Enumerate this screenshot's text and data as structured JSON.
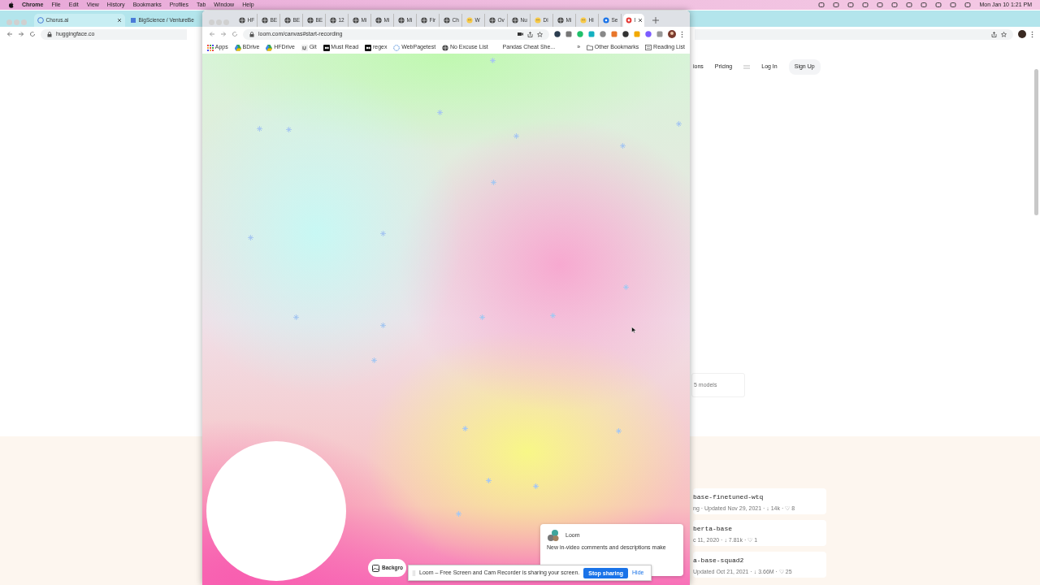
{
  "menubar": {
    "app": "Chrome",
    "menus": [
      "File",
      "Edit",
      "View",
      "History",
      "Bookmarks",
      "Profiles",
      "Tab",
      "Window",
      "Help"
    ],
    "clock": "Mon Jan 10  1:21 PM"
  },
  "back_window": {
    "tabs": [
      {
        "title": "Chorus.ai",
        "selected": true
      },
      {
        "title": "BigScience / VentureBe",
        "selected": false
      }
    ],
    "address": "huggingface.co",
    "nav": [
      "ions",
      "Pricing"
    ],
    "login": "Log In",
    "signup": "Sign Up",
    "models_count": "5 models",
    "models": [
      {
        "name": "base-finetuned-wtq",
        "meta": "ng  ·  Updated Nov 29, 2021  ·  ↓ 14k  ·  ♡ 8"
      },
      {
        "name": "berta-base",
        "meta": "c 11, 2020  ·  ↓ 7.81k  ·  ♡ 1"
      },
      {
        "name": "a-base-squad2",
        "meta": "Updated Oct 21, 2021  ·  ↓ 3.66M  ·  ♡ 25"
      }
    ]
  },
  "front_window": {
    "tabs": [
      {
        "title": "HF",
        "kind": "globe",
        "selected": false
      },
      {
        "title": "BE",
        "kind": "globe",
        "selected": false
      },
      {
        "title": "BE",
        "kind": "globe",
        "selected": false
      },
      {
        "title": "BE",
        "kind": "globe",
        "selected": false
      },
      {
        "title": "12",
        "kind": "globe",
        "selected": false
      },
      {
        "title": "Mi",
        "kind": "globe",
        "selected": false
      },
      {
        "title": "Mi",
        "kind": "globe",
        "selected": false
      },
      {
        "title": "Mi",
        "kind": "globe",
        "selected": false
      },
      {
        "title": "Fir",
        "kind": "globe",
        "selected": false
      },
      {
        "title": "Ch",
        "kind": "globe",
        "selected": false
      },
      {
        "title": "W",
        "kind": "face",
        "selected": false
      },
      {
        "title": "Ov",
        "kind": "globe",
        "selected": false
      },
      {
        "title": "Nu",
        "kind": "globe",
        "selected": false
      },
      {
        "title": "Di",
        "kind": "face",
        "selected": false
      },
      {
        "title": "Mi",
        "kind": "globe",
        "selected": false
      },
      {
        "title": "Hi",
        "kind": "face",
        "selected": false
      },
      {
        "title": "Se",
        "kind": "gear",
        "selected": false
      },
      {
        "title": "I",
        "kind": "record",
        "selected": true
      }
    ],
    "address": "loom.com/canvas#start-recording",
    "bookmarks": [
      {
        "label": "Apps",
        "kind": "apps"
      },
      {
        "label": "BDrive",
        "kind": "drive"
      },
      {
        "label": "HFDrive",
        "kind": "drive"
      },
      {
        "label": "Git",
        "kind": "git"
      },
      {
        "label": "Must Read",
        "kind": "dark"
      },
      {
        "label": "regex",
        "kind": "dark"
      },
      {
        "label": "WebPagetest",
        "kind": "ring"
      },
      {
        "label": "No Excuse List",
        "kind": "globe"
      },
      {
        "label": "Pandas Cheat She...",
        "kind": "none"
      }
    ],
    "overflow": "»",
    "other_bookmarks": "Other Bookmarks",
    "reading_list": "Reading List",
    "background_button": "Backgro",
    "notification": {
      "sender": "Loom",
      "text": "New in-video comments and descriptions make"
    }
  },
  "share_bar": {
    "message": "Loom – Free Screen and Cam Recorder is sharing your screen.",
    "stop": "Stop sharing",
    "hide": "Hide"
  }
}
